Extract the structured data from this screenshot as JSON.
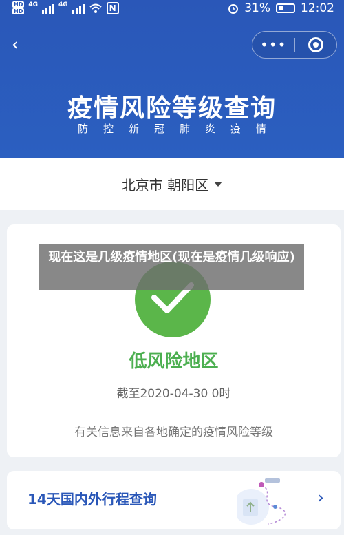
{
  "status_bar": {
    "hd1": "HD",
    "hd2": "HD",
    "net1": "4G",
    "net2": "4G",
    "nfc": "N",
    "battery": "31%",
    "time": "12:02"
  },
  "nav": {
    "back": "‹",
    "more": "•••"
  },
  "header": {
    "title": "疫情风险等级查询",
    "subtitle": "防控新冠肺炎疫情"
  },
  "region": {
    "label": "北京市 朝阳区"
  },
  "result": {
    "level": "低风险地区",
    "as_of": "截至2020-04-30 0时",
    "source": "有关信息来自各地确定的疫情风险等级",
    "color": "#4caf50"
  },
  "overlay": {
    "text": "现在这是几级疫情地区(现在是疫情几级响应)"
  },
  "trip": {
    "label": "14天国内外行程查询",
    "arrow": "›"
  },
  "colors": {
    "brand": "#2a57b8",
    "success": "#5bb64a"
  }
}
